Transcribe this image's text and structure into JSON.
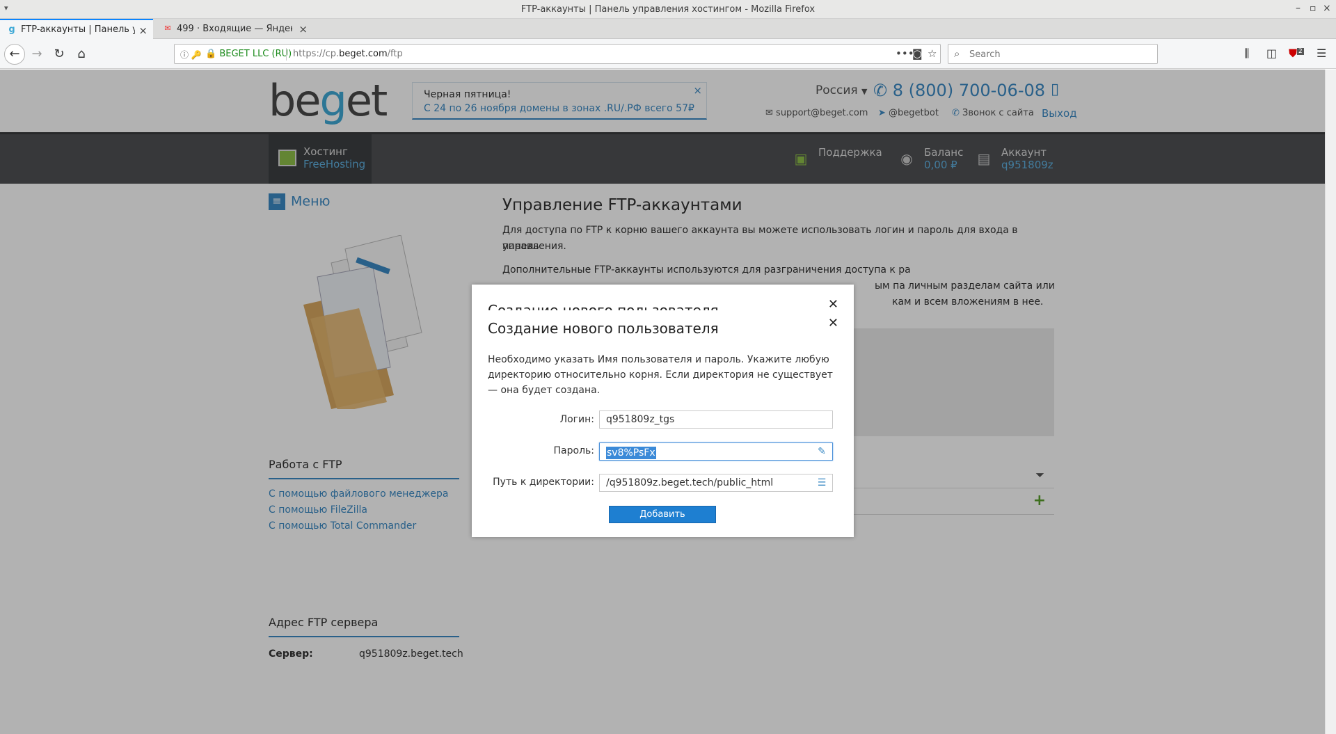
{
  "window": {
    "title": "FTP-аккаунты | Панель управления хостингом - Mozilla Firefox"
  },
  "tabs": [
    {
      "label": "FTP-аккаунты | Панель упр",
      "favicon": "beget-favicon",
      "active": true
    },
    {
      "label": "499 · Входящие — Яндекс.П",
      "favicon": "yandex-mail-favicon",
      "active": false
    }
  ],
  "navbar": {
    "ev_cert": "BEGET LLC (RU)",
    "url_prefix": "https://cp.",
    "url_domain": "beget.com",
    "url_path": "/ftp",
    "search_placeholder": "Search",
    "badge": "2"
  },
  "header": {
    "logo_text_1": "be",
    "logo_text_2": "g",
    "logo_text_3": "et",
    "promo_title": "Черная пятница!",
    "promo_text": "С 24 по 26 ноября домены в зонах .RU/.РФ всего 57₽",
    "region": "Россия",
    "phone": "8 (800) 700-06-08",
    "email": "support@beget.com",
    "telegram": "@begetbot",
    "callback": "Звонок с сайта",
    "logout": "Выход"
  },
  "topmenu": {
    "hosting_label": "Хостинг",
    "hosting_plan": "FreeHosting",
    "support": "Поддержка",
    "balance_label": "Баланс",
    "balance_value": "0,00 ₽",
    "account_label": "Аккаунт",
    "account_value": "q951809z"
  },
  "sidebar": {
    "menu_label": "Меню",
    "ftp_work_title": "Работа с FTP",
    "links": [
      "С помощью файлового менеджера",
      "С помощью FileZilla",
      "С помощью Total Commander"
    ],
    "ftp_addr_title": "Адрес FTP сервера",
    "server_label": "Сервер:",
    "server_value": "q951809z.beget.tech"
  },
  "main": {
    "title": "Управление FTP-аккаунтами",
    "para1_line1": "Для доступа по FTP к корню вашего аккаунта вы можете использовать логин и пароль для входа в панель",
    "para1_line2": "управления.",
    "para2_line1": "Дополнительные FTP-аккаунты используются для разграничения доступа к ра",
    "para2_line2_a": "ым па",
    "para2_line2_b": "личным разделам сайта или",
    "para2_line3": "кам и всем вложениям в нее."
  },
  "modal": {
    "title": "Создание нового пользователя",
    "description": "Необходимо указать Имя пользователя и пароль. Укажите любую директорию относительно корня. Если директория не существует — она будет создана.",
    "login_label": "Логин:",
    "login_value": "q951809z_tgs",
    "password_label": "Пароль:",
    "password_value": "sv8%PsFx",
    "path_label": "Путь к директории:",
    "path_value": "/q951809z.beget.tech/public_html",
    "submit_label": "Добавить"
  },
  "colors": {
    "accent": "#3b8ac4",
    "button": "#1e7fd1",
    "menubar": "#4f5154"
  }
}
